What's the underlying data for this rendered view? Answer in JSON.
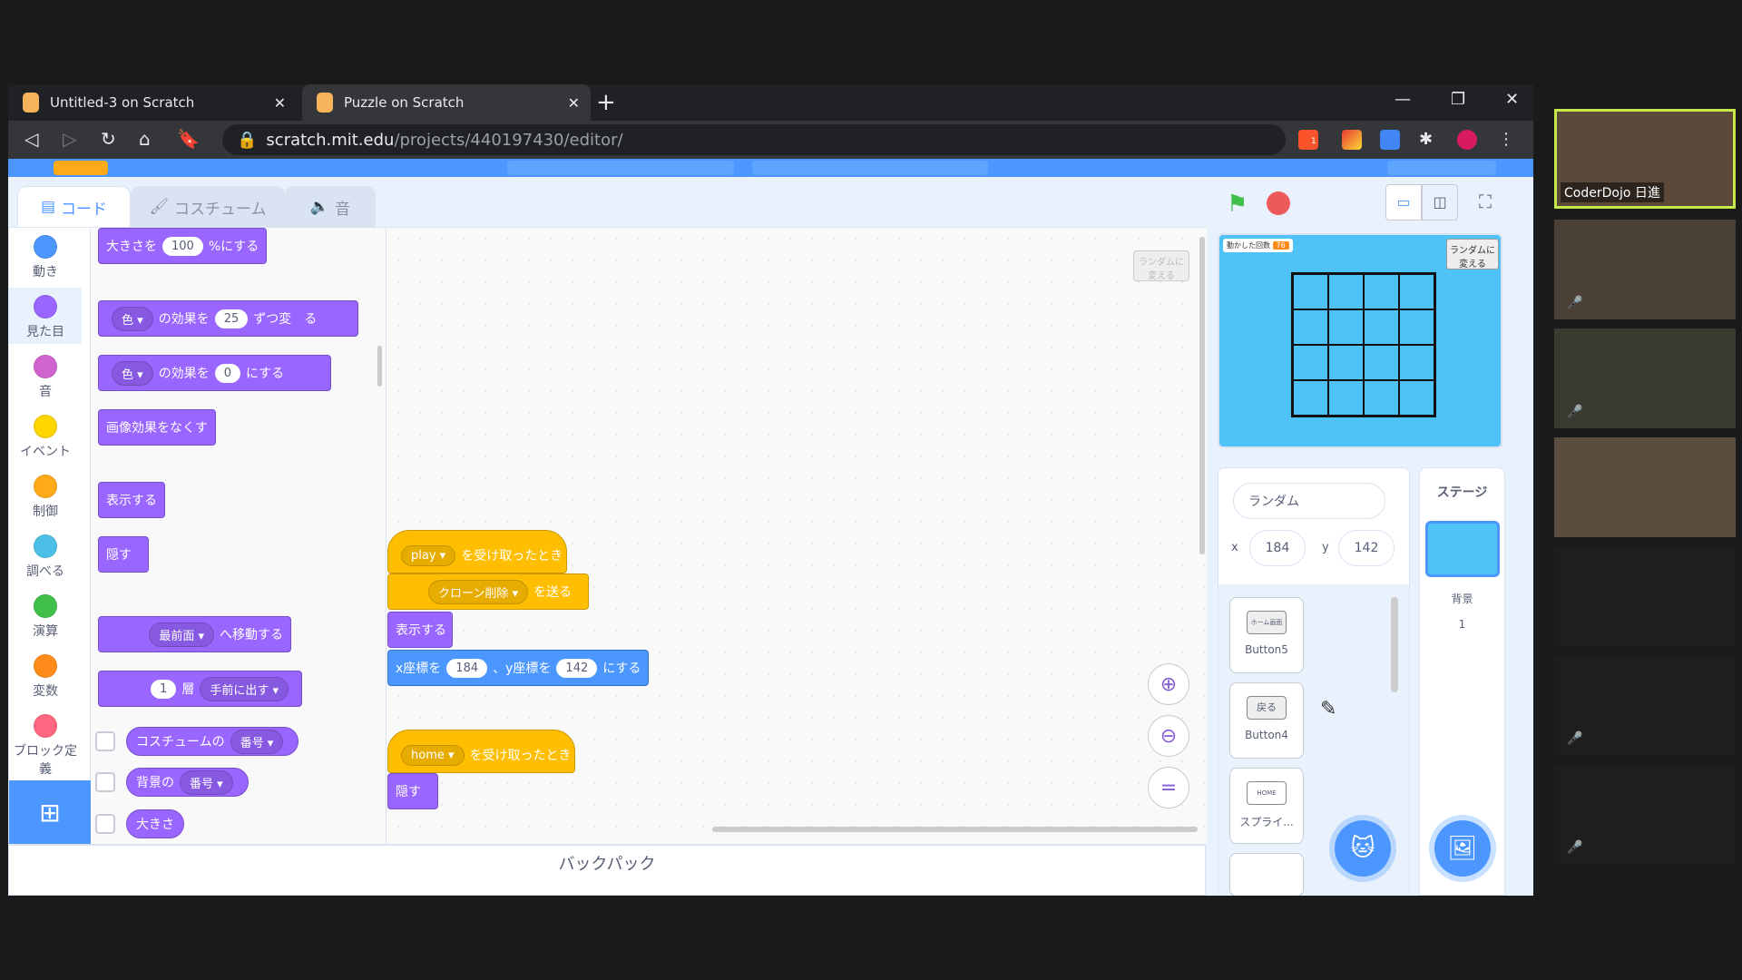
{
  "browser": {
    "tabs": [
      {
        "title": "Untitled-3 on Scratch",
        "active": false
      },
      {
        "title": "Puzzle on Scratch",
        "active": true
      }
    ],
    "new_tab": "+",
    "url_host": "scratch.mit.edu",
    "url_path": "/projects/440197430/editor/",
    "ext_badge": "1"
  },
  "scratch": {
    "tabs": {
      "code": "コード",
      "costume": "コスチューム",
      "sound": "音"
    },
    "categories": [
      {
        "label": "動き",
        "color": "#4c97ff"
      },
      {
        "label": "見た目",
        "color": "#9966ff"
      },
      {
        "label": "音",
        "color": "#cf63cf"
      },
      {
        "label": "イベント",
        "color": "#ffd500"
      },
      {
        "label": "制御",
        "color": "#ffab19"
      },
      {
        "label": "調べる",
        "color": "#4cbfe6"
      },
      {
        "label": "演算",
        "color": "#40bf4a"
      },
      {
        "label": "変数",
        "color": "#ff8c1a"
      },
      {
        "label": "ブロック定義",
        "color": "#ff6680"
      }
    ],
    "palette": {
      "size_a": "大きさを",
      "size_val": "100",
      "size_b": "%にする",
      "color_dd": "色",
      "effect_a": "の効果を",
      "effect_val1": "25",
      "effect_b1": "ずつ変",
      "effect_c1": "る",
      "effect_val2": "0",
      "effect_b2": "にする",
      "clear_effects": "画像効果をなくす",
      "show": "表示する",
      "hide": "隠す",
      "front_dd": "最前面",
      "front_b": "へ移動する",
      "layer_val": "1",
      "layer_a": "層",
      "layer_dd": "手前に出す",
      "costume_a": "コスチュームの",
      "costume_dd": "番号",
      "backdrop_a": "背景の",
      "backdrop_dd": "番号",
      "size_reporter": "大きさ"
    },
    "script1": {
      "msg": "play",
      "when_recv": "を受け取ったとき",
      "clone_dd": "クローン削除",
      "send": "を送る",
      "show": "表示する",
      "x_a": "x座標を",
      "x_val": "184",
      "y_a": "、y座標を",
      "y_val": "142",
      "xy_b": "にする"
    },
    "script2": {
      "msg": "home",
      "when_recv": "を受け取ったとき",
      "hide": "隠す"
    },
    "workspace_note": "ランダムに変える",
    "backpack": "バックパック",
    "stage": {
      "counter_label": "動かした回数",
      "counter_val": "76",
      "random_btn": "ランダムに変える"
    },
    "sprite_info": {
      "name": "ランダム",
      "x_label": "x",
      "x": "184",
      "y_label": "y",
      "y": "142"
    },
    "sprites": [
      {
        "name": "Button5",
        "img_label": "ホーム画面"
      },
      {
        "name": "Button4",
        "img_label": "戻る"
      },
      {
        "name": "スプライ...",
        "img_label": "HOME"
      }
    ],
    "stage_panel": {
      "title": "ステージ",
      "backdrop_label": "背景",
      "backdrop_count": "1"
    }
  },
  "meeting": {
    "participants": [
      {
        "name": "CoderDojo 日進",
        "active": true,
        "muted": false
      },
      {
        "name": "",
        "muted": true
      },
      {
        "name": "",
        "muted": true
      },
      {
        "name": "",
        "muted": false
      }
    ]
  }
}
